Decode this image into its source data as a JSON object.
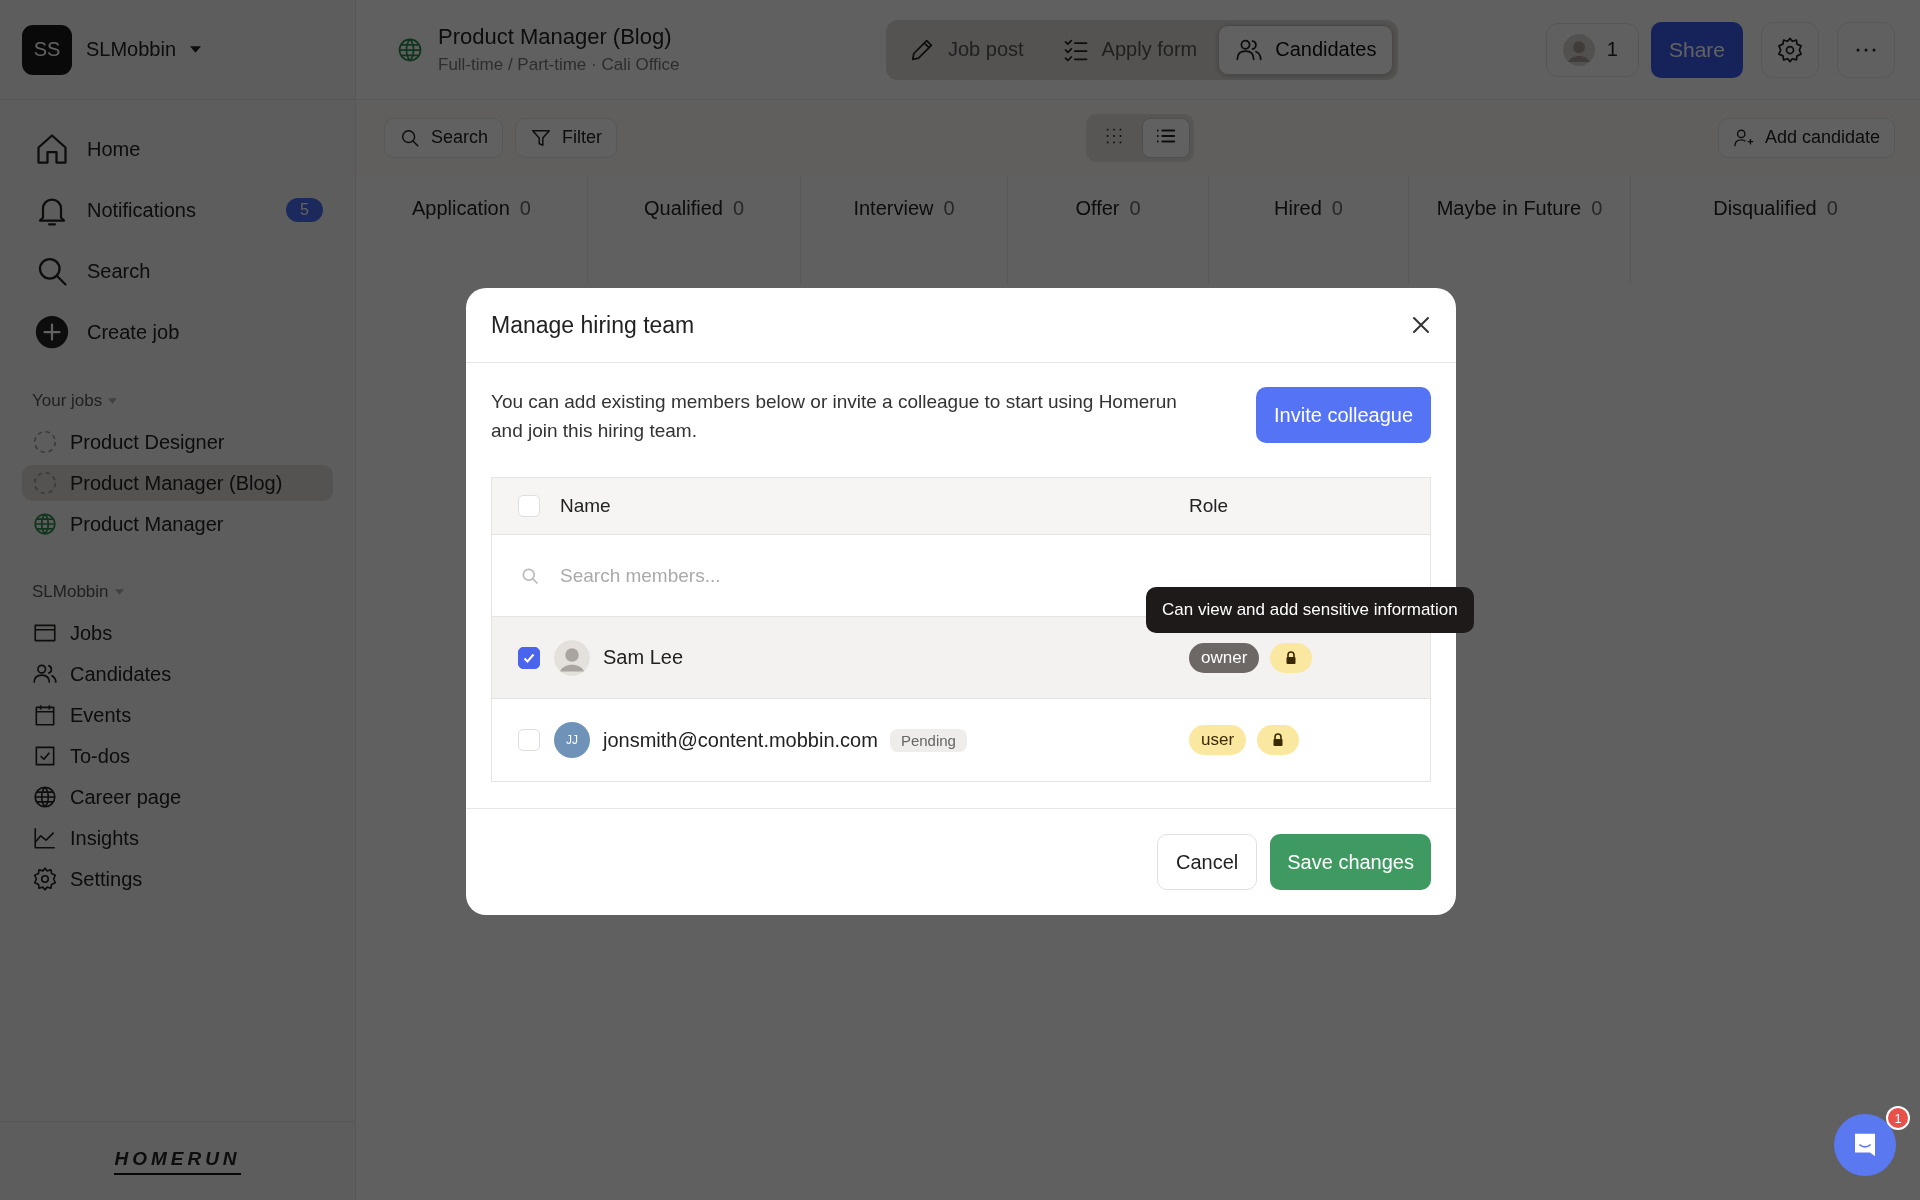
{
  "workspace": {
    "initials": "SS",
    "name": "SLMobbin"
  },
  "nav": [
    {
      "label": "Home"
    },
    {
      "label": "Notifications",
      "badge": "5"
    },
    {
      "label": "Search"
    },
    {
      "label": "Create job"
    }
  ],
  "your_jobs": {
    "heading": "Your jobs",
    "items": [
      {
        "label": "Product Designer",
        "kind": "draft",
        "selected": false
      },
      {
        "label": "Product Manager (Blog)",
        "kind": "draft",
        "selected": true
      },
      {
        "label": "Product Manager",
        "kind": "published",
        "selected": false
      }
    ]
  },
  "company": {
    "heading": "SLMobbin",
    "items": [
      {
        "label": "Jobs"
      },
      {
        "label": "Candidates"
      },
      {
        "label": "Events"
      },
      {
        "label": "To-dos"
      },
      {
        "label": "Career page"
      },
      {
        "label": "Insights"
      },
      {
        "label": "Settings"
      }
    ]
  },
  "logo": "HOMERUN",
  "job": {
    "title": "Product Manager (Blog)",
    "subtitle": "Full-time / Part-time · Cali Office"
  },
  "job_tabs": [
    {
      "label": "Job post",
      "selected": false
    },
    {
      "label": "Apply form",
      "selected": false
    },
    {
      "label": "Candidates",
      "selected": true
    }
  ],
  "team_count": "1",
  "share": "Share",
  "toolbar": {
    "search": "Search",
    "filter": "Filter",
    "views": [
      {
        "selected": false
      },
      {
        "selected": true
      }
    ],
    "add_candidate": "Add candidate"
  },
  "stages": [
    {
      "name": "Application",
      "count": "0"
    },
    {
      "name": "Qualified",
      "count": "0"
    },
    {
      "name": "Interview",
      "count": "0"
    },
    {
      "name": "Offer",
      "count": "0"
    },
    {
      "name": "Hired",
      "count": "0"
    },
    {
      "name": "Maybe in Future",
      "count": "0"
    },
    {
      "name": "Disqualified",
      "count": "0"
    }
  ],
  "modal": {
    "title": "Manage hiring team",
    "description": "You can add existing members below or invite a colleague to start using Homerun and join this hiring team.",
    "invite": "Invite colleague",
    "columns": [
      "Name",
      "Role"
    ],
    "select_all_checked": false,
    "search_placeholder": "Search members...",
    "tooltip": "Can view and add sensitive information",
    "members": [
      {
        "name": "Sam Lee",
        "kind": "photo",
        "checked": true,
        "hovered": true,
        "role": "owner",
        "color": "#6d6866"
      },
      {
        "name": "jonsmith@content.mobbin.com",
        "kind": "initials",
        "initials": "JJ",
        "badge": "Pending",
        "checked": false,
        "hovered": false,
        "role": "user",
        "color": "#fbe8a0"
      }
    ],
    "cancel": "Cancel",
    "save": "Save changes"
  },
  "chat": {
    "badge": "1"
  }
}
